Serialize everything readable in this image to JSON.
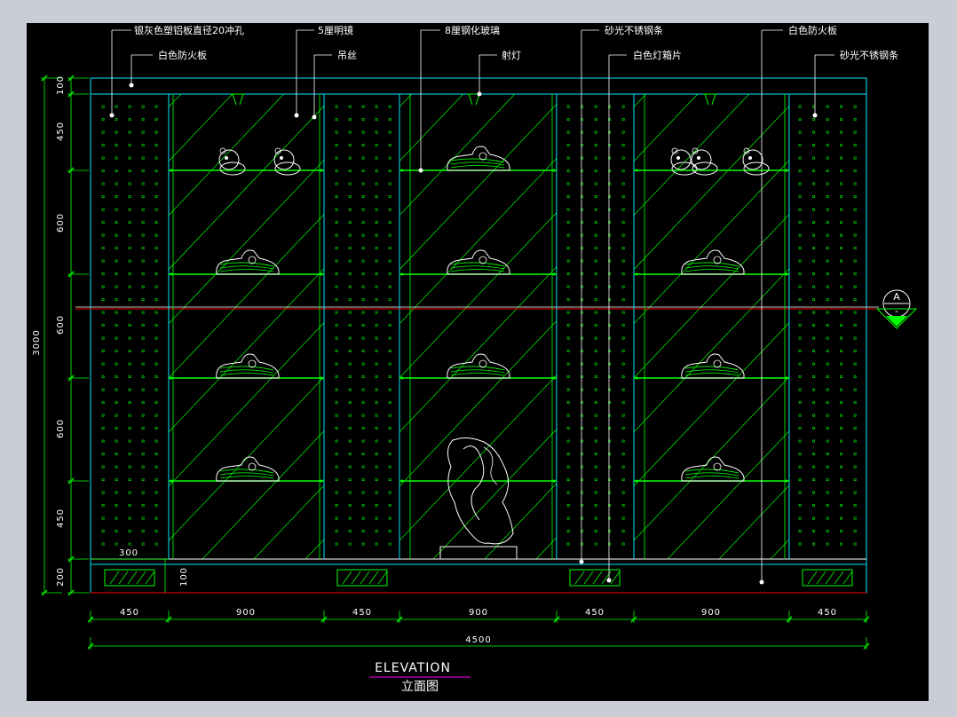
{
  "callouts_top": [
    "银灰色塑铝板直径20冲孔",
    "5厘明镜",
    "8厘钢化玻璃",
    "砂光不锈钢条",
    "白色防火板"
  ],
  "callouts_second": [
    "白色防火板",
    "吊丝",
    "射灯",
    "白色灯箱片",
    "砂光不锈钢条"
  ],
  "dims_horizontal": [
    "450",
    "900",
    "450",
    "900",
    "450",
    "900",
    "450"
  ],
  "dim_total": "4500",
  "dims_vertical": [
    "100",
    "450",
    "600",
    "600",
    "600",
    "450",
    "200"
  ],
  "dim_vertical_total": "3000",
  "dim_small_300": "300",
  "dim_small_100": "100",
  "section_marker": "A",
  "section_marker_sub": "-",
  "title_en": "ELEVATION",
  "title_cn": "立面图",
  "colors": {
    "background": "#000000",
    "frame": "#c8cdd6",
    "lines": "#00ff00",
    "cyan": "#00e5ff",
    "white": "#ffffff",
    "red": "#ff0000",
    "magenta": "#ff00ff"
  }
}
